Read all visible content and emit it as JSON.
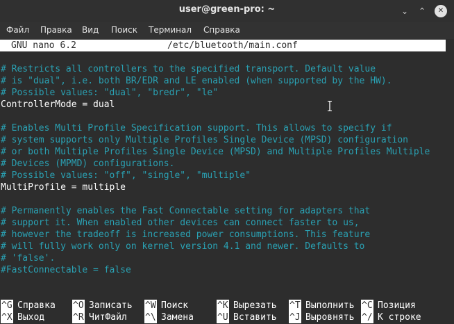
{
  "window": {
    "title": "user@green-pro: ~",
    "minimize_glyph": "⌄",
    "maximize_glyph": "⌃",
    "close_glyph": "✕"
  },
  "menubar": [
    "Файл",
    "Правка",
    "Вид",
    "Поиск",
    "Терминал",
    "Справка"
  ],
  "nano": {
    "version": "GNU nano 6.2",
    "filename": "/etc/bluetooth/main.conf"
  },
  "content_lines": [
    {
      "text": "# Restricts all controllers to the specified transport. Default value",
      "kind": "comment"
    },
    {
      "text": "# is \"dual\", i.e. both BR/EDR and LE enabled (when supported by the HW).",
      "kind": "comment"
    },
    {
      "text": "# Possible values: \"dual\", \"bredr\", \"le\"",
      "kind": "comment"
    },
    {
      "text": "ControllerMode = dual",
      "kind": "setting"
    },
    {
      "text": "",
      "kind": "blank"
    },
    {
      "text": "# Enables Multi Profile Specification support. This allows to specify if",
      "kind": "comment"
    },
    {
      "text": "# system supports only Multiple Profiles Single Device (MPSD) configuration",
      "kind": "comment"
    },
    {
      "text": "# or both Multiple Profiles Single Device (MPSD) and Multiple Profiles Multiple",
      "kind": "comment"
    },
    {
      "text": "# Devices (MPMD) configurations.",
      "kind": "comment"
    },
    {
      "text": "# Possible values: \"off\", \"single\", \"multiple\"",
      "kind": "comment"
    },
    {
      "text": "MultiProfile = multiple",
      "kind": "setting"
    },
    {
      "text": "",
      "kind": "blank"
    },
    {
      "text": "# Permanently enables the Fast Connectable setting for adapters that",
      "kind": "comment"
    },
    {
      "text": "# support it. When enabled other devices can connect faster to us,",
      "kind": "comment"
    },
    {
      "text": "# however the tradeoff is increased power consumptions. This feature",
      "kind": "comment"
    },
    {
      "text": "# will fully work only on kernel version 4.1 and newer. Defaults to",
      "kind": "comment"
    },
    {
      "text": "# 'false'.",
      "kind": "comment"
    },
    {
      "text": "#FastConnectable = false",
      "kind": "comment"
    }
  ],
  "shortcuts": [
    [
      {
        "key": "^G",
        "label": "Справка"
      },
      {
        "key": "^O",
        "label": "Записать"
      },
      {
        "key": "^W",
        "label": "Поиск"
      },
      {
        "key": "^K",
        "label": "Вырезать"
      },
      {
        "key": "^T",
        "label": "Выполнить"
      },
      {
        "key": "^C",
        "label": "Позиция"
      }
    ],
    [
      {
        "key": "^X",
        "label": "Выход"
      },
      {
        "key": "^R",
        "label": "ЧитФайл"
      },
      {
        "key": "^\\",
        "label": "Замена"
      },
      {
        "key": "^U",
        "label": "Вставить"
      },
      {
        "key": "^J",
        "label": "Выровнять"
      },
      {
        "key": "^/",
        "label": "К строке"
      }
    ]
  ],
  "colors": {
    "comment": "#2aa1b3",
    "text": "#ffffff",
    "background": "#2d2d2d",
    "titlebar": "#303030"
  }
}
